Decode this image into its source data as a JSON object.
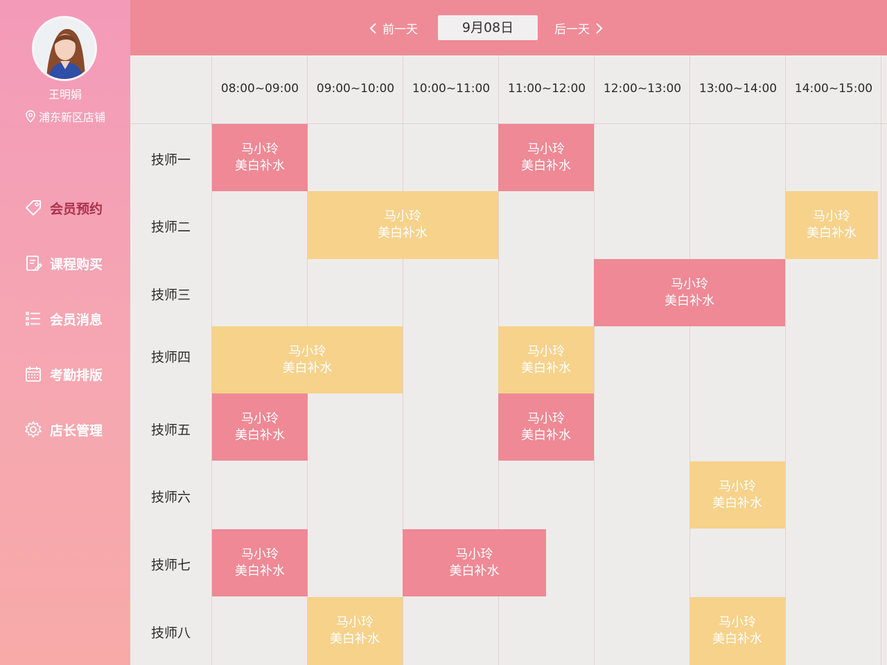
{
  "sidebar": {
    "user_name": "王明娟",
    "location": "浦东新区店铺",
    "menu": [
      {
        "label": "会员预约",
        "icon": "tag-icon",
        "active": true
      },
      {
        "label": "课程购买",
        "icon": "edit-document-icon",
        "active": false
      },
      {
        "label": "会员消息",
        "icon": "list-icon",
        "active": false
      },
      {
        "label": "考勤排版",
        "icon": "calendar-icon",
        "active": false
      },
      {
        "label": "店长管理",
        "icon": "gear-icon",
        "active": false
      }
    ]
  },
  "header": {
    "prev_label": "前一天",
    "date": "9月08日",
    "next_label": "后一天"
  },
  "schedule": {
    "time_slots": [
      "08:00~09:00",
      "09:00~10:00",
      "10:00~11:00",
      "11:00~12:00",
      "12:00~13:00",
      "13:00~14:00",
      "14:00~15:00"
    ],
    "technicians": [
      "技师一",
      "技师二",
      "技师三",
      "技师四",
      "技师五",
      "技师六",
      "技师七",
      "技师八"
    ],
    "bookings": [
      {
        "name": "马小玲",
        "service": "美白补水",
        "color": "#ee8995"
      },
      {
        "name": "马小玲",
        "service": "美白补水",
        "color": "#ee8995"
      },
      {
        "name": "马小玲",
        "service": "美白补水",
        "color": "#f6d28b"
      },
      {
        "name": "马小玲",
        "service": "美白补水",
        "color": "#f6d28b"
      },
      {
        "name": "马小玲",
        "service": "美白补水",
        "color": "#ee8995"
      },
      {
        "name": "马小玲",
        "service": "美白补水",
        "color": "#f6d28b"
      },
      {
        "name": "马小玲",
        "service": "美白补水",
        "color": "#f6d28b"
      },
      {
        "name": "马小玲",
        "service": "美白补水",
        "color": "#ee8995"
      },
      {
        "name": "马小玲",
        "service": "美白补水",
        "color": "#ee8995"
      },
      {
        "name": "马小玲",
        "service": "美白补水",
        "color": "#f6d28b"
      },
      {
        "name": "马小玲",
        "service": "美白补水",
        "color": "#ee8995"
      },
      {
        "name": "马小玲",
        "service": "美白补水",
        "color": "#ee8995"
      },
      {
        "name": "马小玲",
        "service": "美白补水",
        "color": "#f6d28b"
      },
      {
        "name": "马小玲",
        "service": "美白补水",
        "color": "#f6d28b"
      }
    ]
  },
  "colors": {
    "accent_pink": "#ee8995",
    "accent_yellow": "#f6d28b",
    "active_menu": "#a9324d"
  }
}
